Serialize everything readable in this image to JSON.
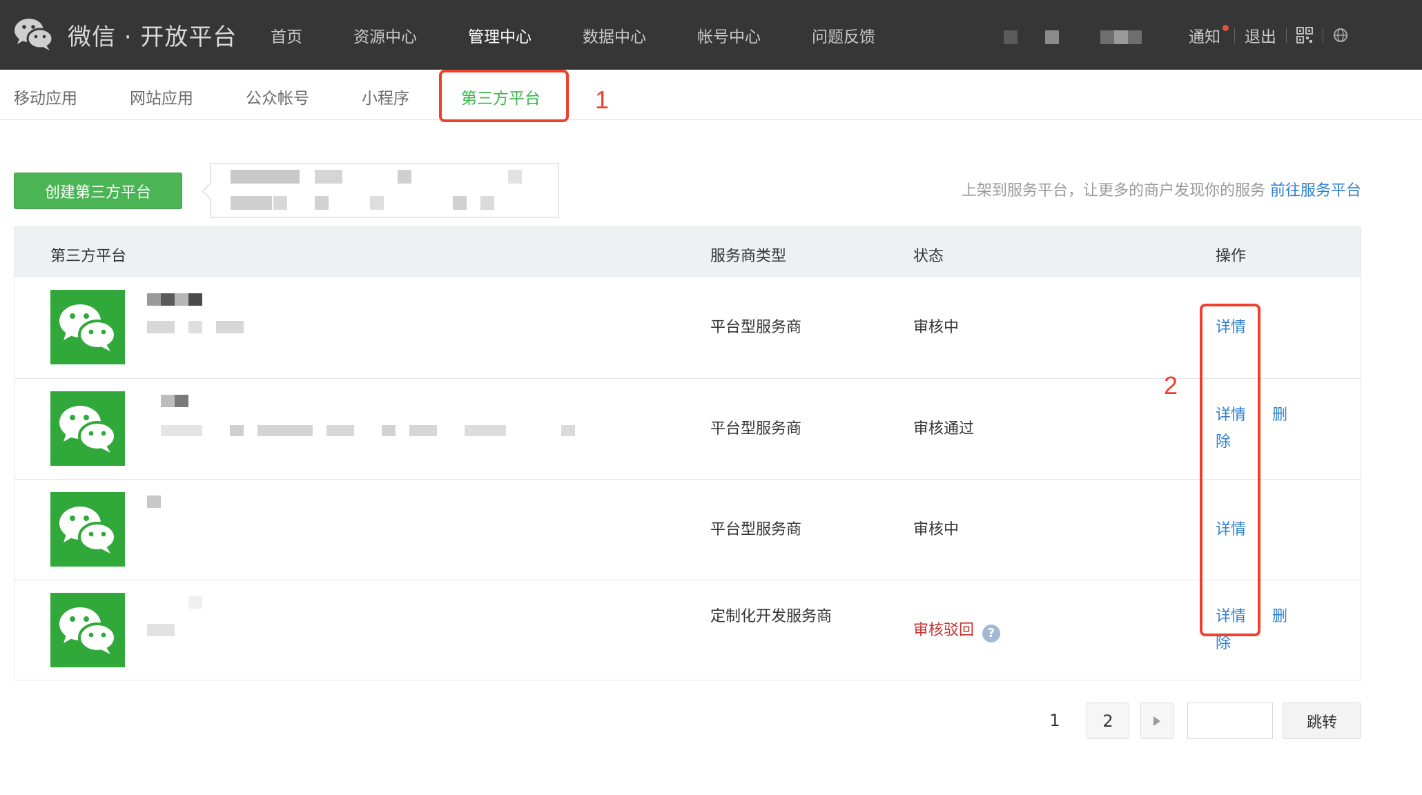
{
  "header": {
    "logo_text": "微信 · 开放平台",
    "nav": [
      "首页",
      "资源中心",
      "管理中心",
      "数据中心",
      "帐号中心",
      "问题反馈"
    ],
    "active_nav": "管理中心",
    "notify": "通知",
    "logout": "退出",
    "qr_icon": "qr-code-icon",
    "lang_icon": "globe-icon"
  },
  "subnav": {
    "tabs": [
      "移动应用",
      "网站应用",
      "公众帐号",
      "小程序",
      "第三方平台"
    ],
    "active": "第三方平台"
  },
  "annotations": {
    "one": "1",
    "two": "2"
  },
  "toolbar": {
    "create_label": "创建第三方平台",
    "promo_text": "上架到服务平台，让更多的商户发现你的服务",
    "promo_link": "前往服务平台"
  },
  "table": {
    "headers": [
      "第三方平台",
      "服务商类型",
      "状态",
      "操作"
    ],
    "rows": [
      {
        "type": "平台型服务商",
        "status": "审核中",
        "ops": [
          "详情"
        ]
      },
      {
        "type": "平台型服务商",
        "status": "审核通过",
        "ops": [
          "详情",
          "删除"
        ]
      },
      {
        "type": "平台型服务商",
        "status": "审核中",
        "ops": [
          "详情"
        ]
      },
      {
        "type": "定制化开发服务商",
        "status": "审核驳回",
        "ops": [
          "详情",
          "删除"
        ]
      }
    ]
  },
  "colors": {
    "accent_green": "#4bb556",
    "link_blue": "#2f80cf",
    "rejected_red": "#c8302d",
    "annotation_red": "#ef3f2d"
  },
  "pagination": {
    "pages": [
      "1",
      "2"
    ],
    "next_icon": "triangle-right-icon",
    "jump_label": "跳转"
  }
}
